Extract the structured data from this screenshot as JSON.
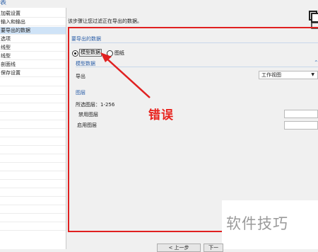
{
  "window": {
    "title_glyph": "表"
  },
  "sidebar": {
    "items": [
      {
        "label": "加载设置",
        "selected": false
      },
      {
        "label": "输入和输出",
        "selected": false
      },
      {
        "label": "要导出的数据",
        "selected": true
      },
      {
        "label": "选项",
        "selected": false
      },
      {
        "label": "线型",
        "selected": false
      },
      {
        "label": "线型",
        "selected": false
      },
      {
        "label": "剖面线",
        "selected": false
      },
      {
        "label": "保存设置",
        "selected": false
      }
    ]
  },
  "main": {
    "instruction": "该步骤让您过滤正在导出的数据。",
    "group_title": "要导出的数据",
    "radio_model": "模型数据",
    "radio_drawing": "图纸",
    "sub_section_title": "模型数据",
    "export_label": "导出",
    "export_value": "工作视图",
    "layer_section": "图层",
    "selected_layers": "所选图层：1-256",
    "disabled_layers": "禁用图层",
    "enabled_layers": "启用图层"
  },
  "annotation": {
    "error_text": "错误",
    "color": "#e02020"
  },
  "watermark": {
    "text": "软件技巧"
  },
  "footer": {
    "back_label": "< 上一步",
    "next_label": "下一"
  }
}
